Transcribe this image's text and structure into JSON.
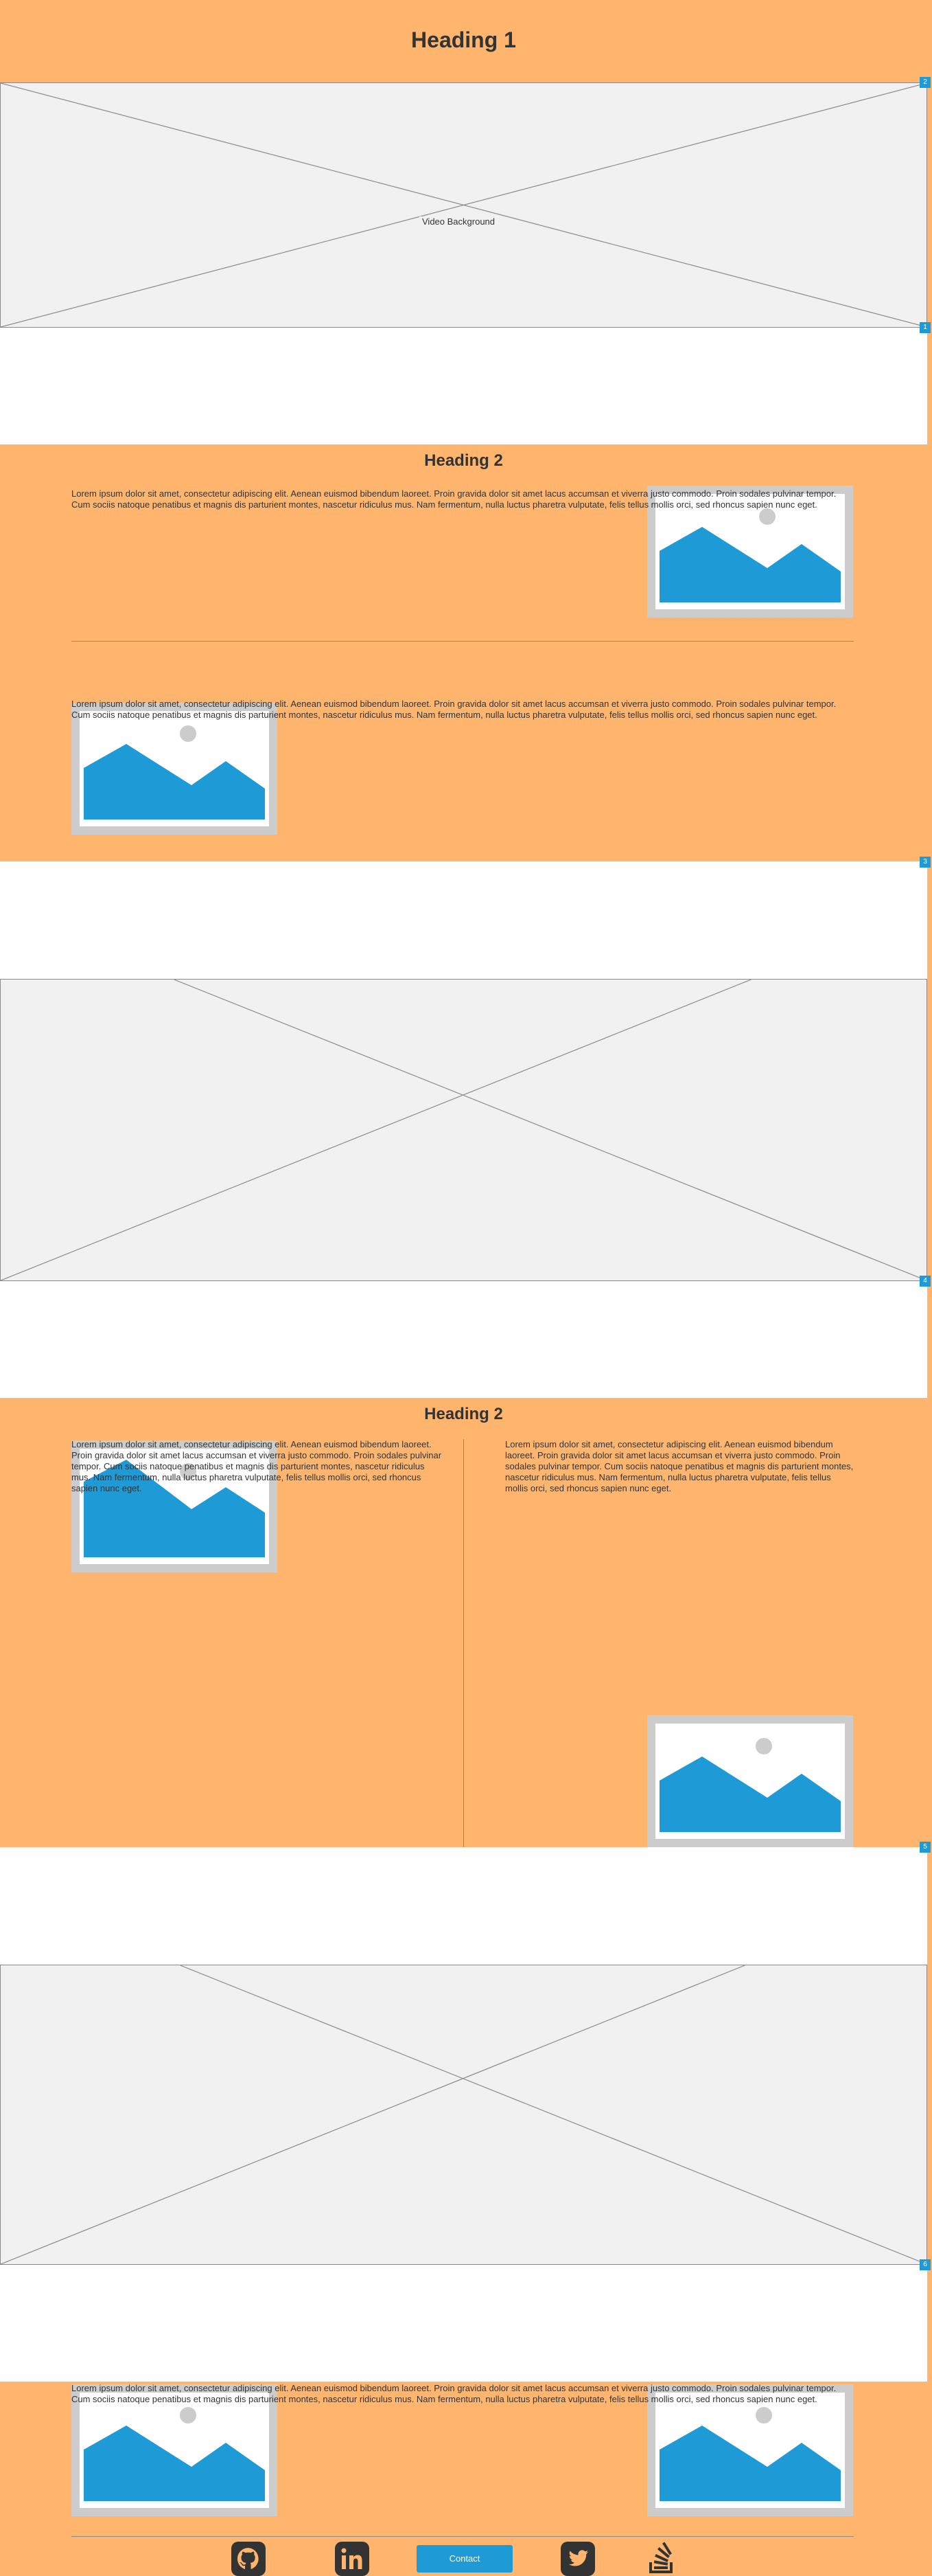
{
  "page": {
    "heading1": "Heading 1",
    "video_label": "Video Background",
    "section1": {
      "heading": "Heading 2"
    },
    "section2": {
      "heading": "Heading 2"
    },
    "lorem": "Lorem ipsum dolor sit amet, consectetur adipiscing elit. Aenean euismod bibendum laoreet. Proin gravida dolor sit amet lacus accumsan et viverra justo commodo. Proin sodales pulvinar tempor. Cum sociis natoque penatibus et magnis dis parturient montes, nascetur ridiculus mus. Nam fermentum, nulla luctus pharetra vulputate, felis tellus mollis orci, sed rhoncus sapien nunc eget.",
    "markers": [
      "2",
      "1",
      "3",
      "4",
      "5",
      "6"
    ],
    "footer": {
      "contact_label": "Contact"
    }
  },
  "colors": {
    "section_bg": "#ffb56e",
    "accent": "#1e9ad6",
    "placeholder_bg": "#f1f1f1",
    "dark_icon": "#333333"
  },
  "icons": [
    "github-icon",
    "linkedin-icon",
    "twitter-icon",
    "stackoverflow-icon",
    "image-placeholder-icon"
  ]
}
